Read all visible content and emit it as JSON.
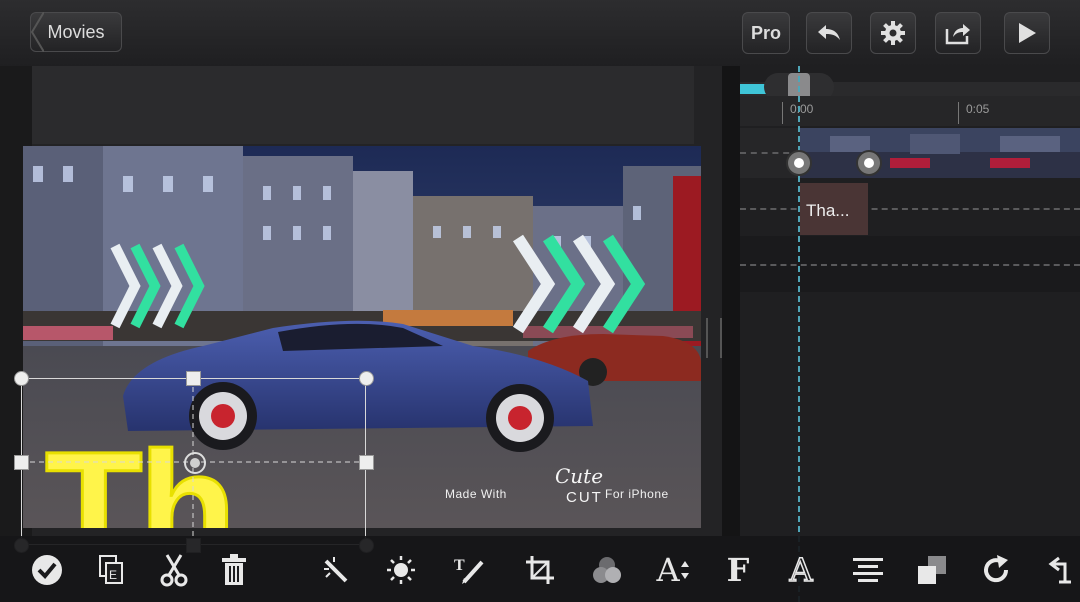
{
  "topbar": {
    "back_label": "Movies",
    "pro_label": "Pro",
    "icons": [
      "undo-icon",
      "gear-icon",
      "share-icon",
      "play-icon"
    ]
  },
  "preview": {
    "watermark": {
      "made_with": "Made With",
      "cute": "Cute",
      "cut": "CUT",
      "for_iphone": "For iPhone"
    },
    "text_overlay": "Th"
  },
  "timeline": {
    "ticks": [
      "0:00",
      "0:05"
    ],
    "text_clip_label": "Tha..."
  },
  "toolbar": {
    "icons": [
      "checkmark-icon",
      "duplicate-icon",
      "scissors-icon",
      "trash-icon",
      "magic-wand-icon",
      "brightness-icon",
      "text-edit-icon",
      "crop-icon",
      "color-circles-icon",
      "font-size-icon",
      "font-icon",
      "text-outline-icon",
      "align-center-icon",
      "layers-icon",
      "rotate-icon",
      "flip-icon"
    ],
    "font_size_label": "A",
    "font_label": "F",
    "outline_label": "A"
  }
}
